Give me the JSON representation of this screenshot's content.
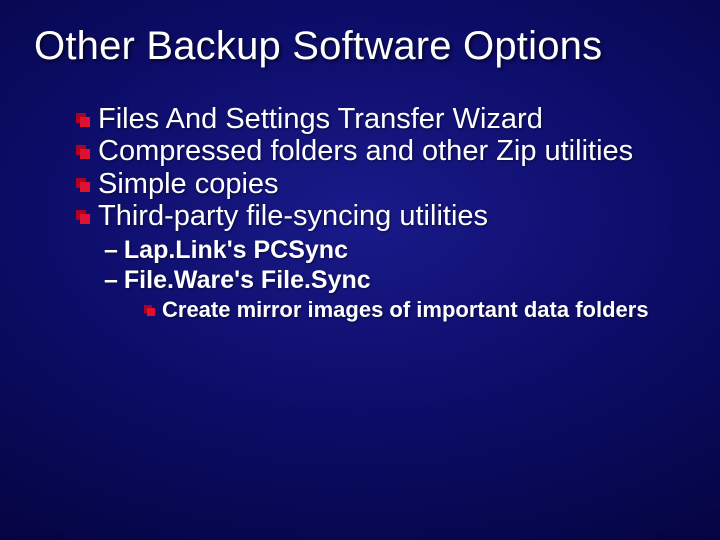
{
  "title": "Other Backup Software Options",
  "bullets": {
    "b0": "Files And Settings Transfer Wizard",
    "b1": "Compressed folders and other Zip utilities",
    "b2": "Simple copies",
    "b3": "Third-party file-syncing utilities"
  },
  "subs": {
    "s0": "Lap.Link's PCSync",
    "s1": "File.Ware's File.Sync"
  },
  "subsubs": {
    "ss0": "Create mirror images of important data folders"
  }
}
